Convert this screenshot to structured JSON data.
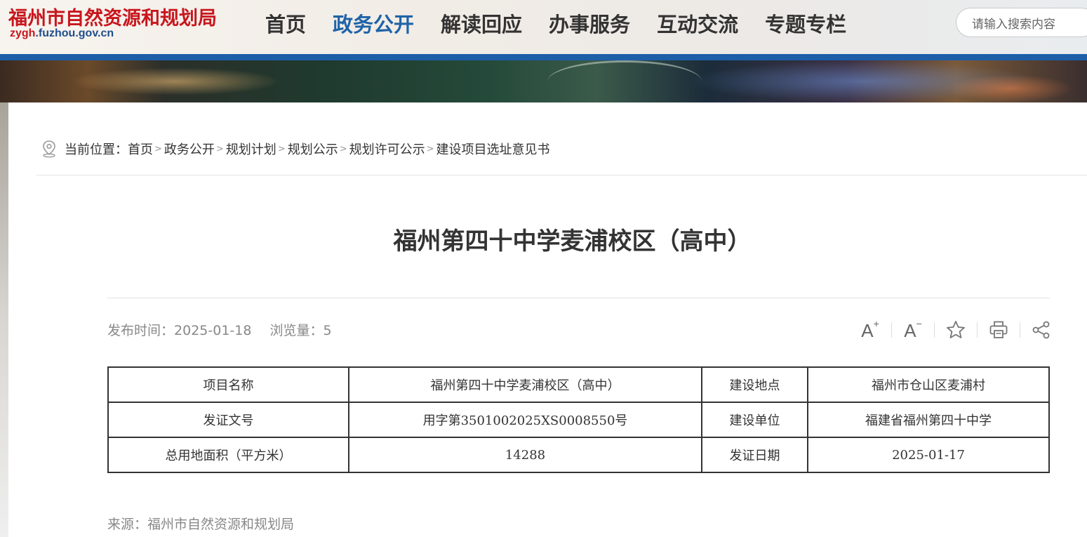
{
  "header": {
    "site_title": "福州市自然资源和规划局",
    "site_domain_highlight": "zygh",
    "site_domain_rest": ".fuzhou.gov.cn",
    "nav": [
      {
        "label": "首页",
        "active": false
      },
      {
        "label": "政务公开",
        "active": true
      },
      {
        "label": "解读回应",
        "active": false
      },
      {
        "label": "办事服务",
        "active": false
      },
      {
        "label": "互动交流",
        "active": false
      },
      {
        "label": "专题专栏",
        "active": false
      }
    ],
    "search_placeholder": "请输入搜索内容"
  },
  "breadcrumb": {
    "prefix": "当前位置：",
    "items": [
      "首页",
      "政务公开",
      "规划计划",
      "规划公示",
      "规划许可公示",
      "建设项目选址意见书"
    ],
    "separator": ">"
  },
  "article": {
    "title": "福州第四十中学麦浦校区（高中）",
    "publish_label": "发布时间：",
    "publish_date": "2025-01-18",
    "views_label": "浏览量：",
    "views": "5",
    "source": "来源：福州市自然资源和规划局"
  },
  "tools": [
    {
      "name": "font-increase-icon",
      "glyph": "A",
      "sup": "+"
    },
    {
      "name": "font-decrease-icon",
      "glyph": "A",
      "sup": "−"
    },
    {
      "name": "star-icon"
    },
    {
      "name": "print-icon"
    },
    {
      "name": "share-icon"
    }
  ],
  "table": {
    "rows": [
      [
        "项目名称",
        "福州第四十中学麦浦校区（高中）",
        "建设地点",
        "福州市仓山区麦浦村"
      ],
      [
        "发证文号",
        "用字第3501002025XS0008550号",
        "建设单位",
        "福建省福州第四十中学"
      ],
      [
        "总用地面积（平方米）",
        "14288",
        "发证日期",
        "2025-01-17"
      ]
    ]
  },
  "colors": {
    "brand_red": "#c8161d",
    "nav_active": "#1f63a8",
    "header_bar": "#1d5ea8"
  }
}
